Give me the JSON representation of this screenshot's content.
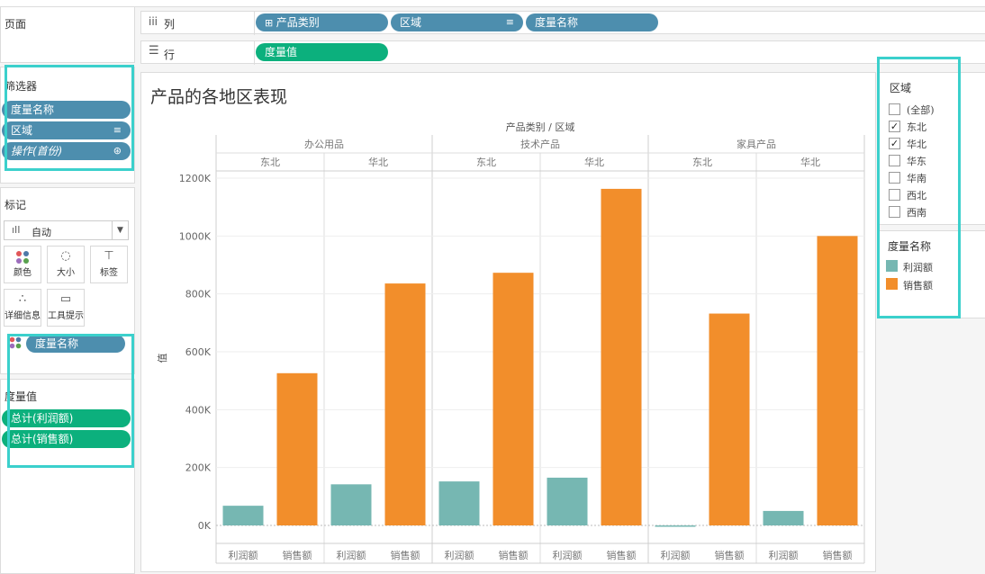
{
  "left_pane": {
    "pages_title": "页面",
    "filters_title": "筛选器",
    "filters": [
      {
        "label": "度量名称",
        "suffix": ""
      },
      {
        "label": "区域",
        "suffix": "≡"
      },
      {
        "label": "操作(首份)",
        "suffix": "⊛"
      }
    ],
    "marks_title": "标记",
    "mark_type": "自动",
    "mark_buttons": [
      {
        "label": "颜色",
        "icon": "color-icon"
      },
      {
        "label": "大小",
        "icon": "size-icon"
      },
      {
        "label": "标签",
        "icon": "label-icon"
      },
      {
        "label": "详细信息",
        "icon": "detail-icon"
      },
      {
        "label": "工具提示",
        "icon": "tooltip-icon"
      }
    ],
    "marks_pill": "度量名称",
    "measure_values_title": "度量值",
    "measure_values": [
      "总计(利润额)",
      "总计(销售额)"
    ]
  },
  "shelves": {
    "columns_label": "列",
    "columns_pills": [
      "产品类别",
      "区域",
      "度量名称"
    ],
    "rows_label": "行",
    "rows_pills": [
      "度量值"
    ]
  },
  "legend": {
    "region_title": "区域",
    "region_items": [
      {
        "label": "(全部)",
        "checked": false
      },
      {
        "label": "东北",
        "checked": true
      },
      {
        "label": "华北",
        "checked": true
      },
      {
        "label": "华东",
        "checked": false
      },
      {
        "label": "华南",
        "checked": false
      },
      {
        "label": "西北",
        "checked": false
      },
      {
        "label": "西南",
        "checked": false
      }
    ],
    "measure_title": "度量名称",
    "measure_items": [
      {
        "label": "利润额",
        "color": "#76b7b2"
      },
      {
        "label": "销售额",
        "color": "#f28e2b"
      }
    ]
  },
  "chart_data": {
    "type": "bar",
    "title": "产品的各地区表现",
    "header_title": "产品类别 / 区域",
    "ylabel": "值",
    "ylim": [
      0,
      1250000
    ],
    "yticks": [
      0,
      200000,
      400000,
      600000,
      800000,
      1000000,
      1200000
    ],
    "ytick_labels": [
      "0K",
      "200K",
      "400K",
      "600K",
      "800K",
      "1000K",
      "1200K"
    ],
    "grid": true,
    "categories": [
      "办公用品",
      "技术产品",
      "家具产品"
    ],
    "regions": [
      "东北",
      "华北"
    ],
    "measures": [
      "利润额",
      "销售额"
    ],
    "series": [
      {
        "name": "利润额",
        "color": "#76b7b2",
        "values": [
          68000,
          142000,
          152000,
          165000,
          -3000,
          50000
        ]
      },
      {
        "name": "销售额",
        "color": "#f28e2b",
        "values": [
          526000,
          836000,
          873000,
          1163000,
          732000,
          1000000
        ]
      }
    ]
  }
}
